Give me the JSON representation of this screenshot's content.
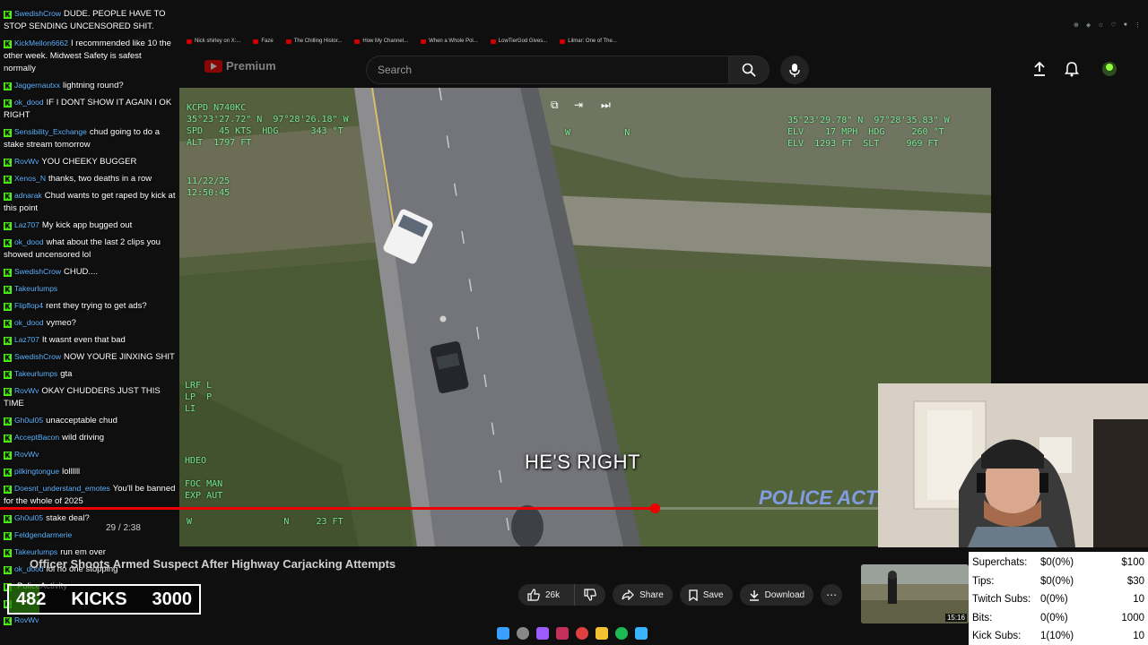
{
  "browser": {
    "bookmarks": [
      "Nick shirley on X:...",
      "Faze",
      "The Chilling Histor...",
      "How My Channel...",
      "When a Whole Pol...",
      "LowTierGod Gives...",
      "Lilmar: One of The..."
    ]
  },
  "youtube": {
    "logo_text": "Premium",
    "search_placeholder": "Search"
  },
  "video": {
    "hud_top_left": "KCPD N740KC\n35°23'27.72\" N  97°28'26.18\" W\nSPD   45 KTS  HDG      343 °T\nALT  1797 FT",
    "hud_date": "11/22/25\n12:50:45",
    "hud_top_right": "35°23'29.78\" N  97°28'35.83\" W\nELV    17 MPH  HDG     260 °T\nELV  1293 FT  SLT     969 FT",
    "hud_mid_left": "LRF L\nLP  P\nLI",
    "hud_bottom_left": "HDEO\n\nFOC MAN\nEXP AUT",
    "hud_bottom": "W                 N     23 FT",
    "hud_compass": "W          N",
    "caption": "HE'S RIGHT",
    "watermark": "POLICE ACTIV",
    "progress_fraction": 0.745,
    "time": "29 / 2:38",
    "title": "Officer Shoots Armed Suspect After Highway Carjacking Attempts",
    "likes": "26k",
    "share_label": "Share",
    "save_label": "Save",
    "download_label": "Download",
    "thumb_duration": "15:16"
  },
  "chat": [
    {
      "user": "SwedishCrow",
      "text": "DUDE. PEOPLE HAVE TO STOP SENDING UNCENSORED SHIT."
    },
    {
      "user": "KickMellon6662",
      "text": "I recommended like 10 the other week. Midwest Safety is safest normally"
    },
    {
      "user": "Jaggernautxx",
      "text": "lightning round?"
    },
    {
      "user": "ok_dood",
      "text": "IF I DONT SHOW IT AGAIN I OK RIGHT"
    },
    {
      "user": "Sensibility_Exchange",
      "text": "chud going to do a stake stream tomorrow"
    },
    {
      "user": "RovWv",
      "text": "YOU CHEEKY BUGGER"
    },
    {
      "user": "Xenos_N",
      "text": "thanks, two deaths in a row"
    },
    {
      "user": "adnarak",
      "text": "Chud wants to get raped by kick at this point"
    },
    {
      "user": "Laz707",
      "text": "My kick app bugged out"
    },
    {
      "user": "ok_dood",
      "text": "what about the last 2 clips you showed uncensored lol"
    },
    {
      "user": "SwedishCrow",
      "text": "CHUD...."
    },
    {
      "user": "Takeurlumps",
      "text": ""
    },
    {
      "user": "Flipflop4",
      "text": "rent they trying to get ads?"
    },
    {
      "user": "ok_dood",
      "text": "vymeo?"
    },
    {
      "user": "Laz707",
      "text": "It wasnt even that bad"
    },
    {
      "user": "SwedishCrow",
      "text": "NOW YOURE JINXING SHIT"
    },
    {
      "user": "Takeurlumps",
      "text": "gta"
    },
    {
      "user": "RovWv",
      "text": "OKAY CHUDDERS JUST THIS TIME"
    },
    {
      "user": "Gh0ul05",
      "text": "unacceptable chud"
    },
    {
      "user": "AcceptBacon",
      "text": "wild driving"
    },
    {
      "user": "RovWv",
      "text": ""
    },
    {
      "user": "pilkingtongue",
      "text": "lollllll"
    },
    {
      "user": "Doesnt_understand_emotes",
      "text": "You'll be banned for the whole of 2025"
    },
    {
      "user": "Gh0ul05",
      "text": "stake deal?"
    },
    {
      "user": "Feldgendarmerie",
      "text": ""
    },
    {
      "user": "Takeurlumps",
      "text": "run em over"
    },
    {
      "user": "ok_dood",
      "text": "lol no one stopping"
    },
    {
      "user": "",
      "text": "PoliceActivity"
    },
    {
      "user": "",
      "text": ""
    },
    {
      "user": "RovWv",
      "text": ""
    }
  ],
  "kicks": {
    "current": "482",
    "label": "KICKS",
    "goal": "3000",
    "fraction": 0.16
  },
  "stats": [
    {
      "label": "Superchats:",
      "value": "$0(0%)",
      "goal": "$100"
    },
    {
      "label": "Tips:",
      "value": "$0(0%)",
      "goal": "$30"
    },
    {
      "label": "Twitch Subs:",
      "value": "0(0%)",
      "goal": "10"
    },
    {
      "label": "Bits:",
      "value": "0(0%)",
      "goal": "1000"
    },
    {
      "label": "Kick Subs:",
      "value": "1(10%)",
      "goal": "10"
    }
  ],
  "colors": {
    "kick_green": "#53fc18",
    "yt_red": "#ff0000",
    "hud_green": "#7dffa0"
  }
}
